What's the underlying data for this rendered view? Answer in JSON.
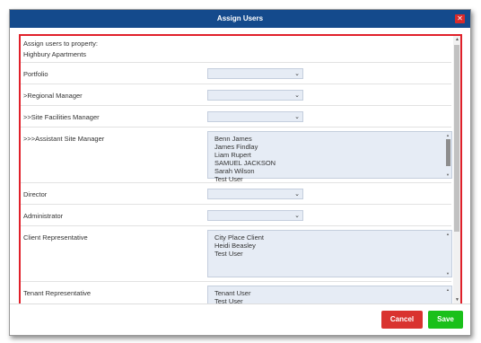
{
  "window": {
    "title": "Assign Users"
  },
  "colors": {
    "titlebar": "#144a8c",
    "highlight_border": "#e0202a",
    "field_bg": "#e6ecf5",
    "cancel": "#d9332f",
    "save": "#1ac01a"
  },
  "form": {
    "heading": "Assign users to property:",
    "property_name": "Highbury Apartments",
    "portfolio": {
      "label": "Portfolio",
      "value": ""
    },
    "regional_manager": {
      "label": ">Regional Manager",
      "value": ""
    },
    "site_facilities_manager": {
      "label": ">>Site Facilities Manager",
      "value": ""
    },
    "assistant_site_manager": {
      "label": ">>>Assistant Site Manager",
      "options": [
        "Benn James",
        "James Findlay",
        "Liam Rupert",
        "SAMUEL JACKSON",
        "Sarah Wilson",
        "Test User"
      ]
    },
    "director": {
      "label": "Director",
      "value": ""
    },
    "administrator": {
      "label": "Administrator",
      "value": ""
    },
    "client_representative": {
      "label": "Client Representative",
      "options": [
        "City Place Client",
        "Heidi Beasley",
        "Test User"
      ]
    },
    "tenant_representative": {
      "label": "Tenant Representative",
      "options": [
        "Tenant User",
        "Test User"
      ]
    }
  },
  "footer": {
    "cancel_label": "Cancel",
    "save_label": "Save"
  }
}
